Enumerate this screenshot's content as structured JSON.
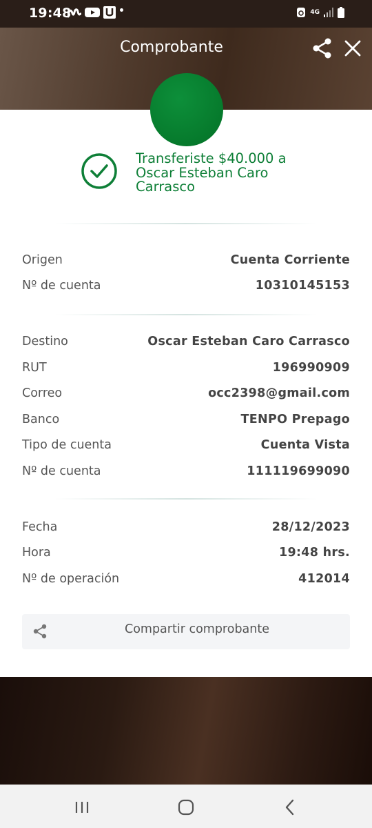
{
  "status_bar": {
    "time": "19:48",
    "network": "4G",
    "icons": [
      "movistar-icon",
      "youtube-icon",
      "u-app-icon",
      "notification-dot",
      "recycle-icon",
      "network-4g-icon",
      "signal-icon",
      "battery-icon"
    ]
  },
  "header": {
    "title": "Comprobante",
    "share_icon": "share-icon",
    "close_icon": "close-icon"
  },
  "success": {
    "message": "Transferiste $40.000 a Oscar Esteban Caro Carrasco",
    "icon": "check-circle-icon"
  },
  "origin": {
    "rows": [
      {
        "label": "Origen",
        "value": "Cuenta Corriente"
      },
      {
        "label": "Nº de cuenta",
        "value": "10310145153"
      }
    ]
  },
  "destination": {
    "rows": [
      {
        "label": "Destino",
        "value": "Oscar Esteban Caro Carrasco"
      },
      {
        "label": "RUT",
        "value": "196990909"
      },
      {
        "label": "Correo",
        "value": "occ2398@gmail.com"
      },
      {
        "label": "Banco",
        "value": "TENPO Prepago"
      },
      {
        "label": "Tipo de cuenta",
        "value": "Cuenta Vista"
      },
      {
        "label": "Nº de cuenta",
        "value": "111119699090"
      }
    ]
  },
  "operation": {
    "rows": [
      {
        "label": "Fecha",
        "value": "28/12/2023"
      },
      {
        "label": "Hora",
        "value": "19:48 hrs."
      },
      {
        "label": "Nº de operación",
        "value": "412014"
      }
    ]
  },
  "share_button": {
    "label": "Compartir comprobante",
    "icon": "share-icon"
  },
  "colors": {
    "accent_green": "#0e7f37",
    "circle_green": "#067a2c",
    "header_brown": "#4f3a2c"
  },
  "nav": {
    "icons": [
      "recent-apps-icon",
      "home-icon",
      "back-icon"
    ]
  }
}
